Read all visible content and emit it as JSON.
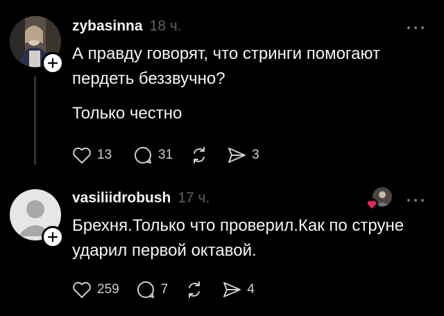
{
  "posts": [
    {
      "username": "zybasinna",
      "time": "18 ч.",
      "text1": "А правду говорят, что стринги помогают\nпердеть беззвучно?",
      "text2": "Только честно",
      "likes": "13",
      "replies": "31",
      "shares": "3"
    },
    {
      "username": "vasiliidrobush",
      "time": "17 ч.",
      "text1": "Брехня.Только что проверил.Как по струне\nударил первой октавой.",
      "likes": "259",
      "replies": "7",
      "shares": "4"
    }
  ],
  "colors": {
    "background": "#000000",
    "text": "#f3f5f7",
    "muted": "#616161",
    "heart": "#e0245e"
  }
}
